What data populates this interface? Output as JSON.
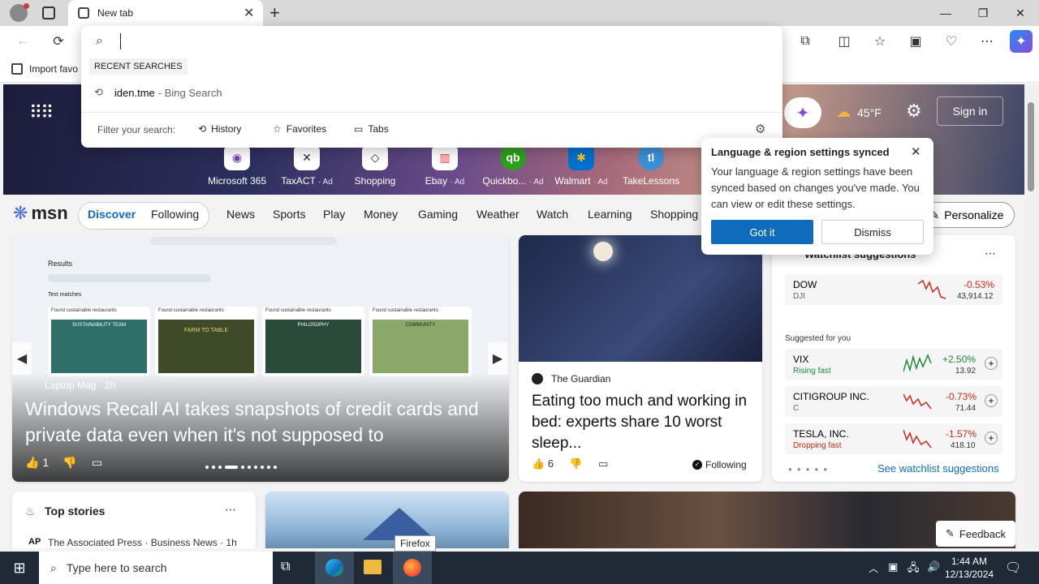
{
  "tab": {
    "title": "New tab"
  },
  "omnibox": {
    "recent_label": "RECENT SEARCHES",
    "recent_item": "iden.tme",
    "recent_item_suffix": "- Bing Search",
    "filter_label": "Filter your search:",
    "filters": [
      "History",
      "Favorites",
      "Tabs"
    ]
  },
  "favbar": {
    "import_label": "Import favo"
  },
  "hero": {
    "weather_temp": "45°F",
    "signin_label": "Sign in",
    "quicklinks": [
      {
        "label": "Microsoft 365",
        "ad": ""
      },
      {
        "label": "TaxACT",
        "ad": "· Ad"
      },
      {
        "label": "Shopping",
        "ad": ""
      },
      {
        "label": "Ebay",
        "ad": "· Ad"
      },
      {
        "label": "Quickbo...",
        "ad": "· Ad"
      },
      {
        "label": "Walmart",
        "ad": "· Ad"
      },
      {
        "label": "TakeLessons",
        "ad": ""
      }
    ]
  },
  "nav": {
    "brand": "msn",
    "discover": "Discover",
    "following": "Following",
    "items": [
      "News",
      "Sports",
      "Play",
      "Money",
      "Gaming",
      "Weather",
      "Watch",
      "Learning",
      "Shopping"
    ],
    "personalize": "Personalize"
  },
  "popup": {
    "title": "Language & region settings synced",
    "body": "Your language & region settings have been synced based on changes you've made. You can view or edit these settings.",
    "got_it": "Got it",
    "dismiss": "Dismiss"
  },
  "main_story": {
    "source": "Laptop Mag · 2h",
    "headline": "Windows Recall AI takes snapshots of credit cards and private data even when it's not supposed to",
    "likes": "1",
    "preview": {
      "results": "Results",
      "text_matches": "Text matches",
      "tile_title": "Found sustainable restaurants",
      "tiles": [
        "SUSTAINABILITY TEAM",
        "FARM TO TABLE",
        "PHILOSOPHY",
        "COMMUNITY"
      ]
    }
  },
  "guardian": {
    "source": "The Guardian",
    "headline": "Eating too much and working in bed: experts share 10 worst sleep...",
    "likes": "6",
    "following": "Following"
  },
  "watchlist": {
    "title": "Watchlist suggestions",
    "primary": {
      "name": "DOW",
      "ticker": "DJI",
      "change": "-0.53%",
      "value": "43,914.12"
    },
    "suggested_label": "Suggested for you",
    "items": [
      {
        "name": "VIX",
        "sub": "Rising fast",
        "change": "+2.50%",
        "value": "13.92",
        "color": "#1a8a3a"
      },
      {
        "name": "CITIGROUP INC.",
        "sub": "C",
        "change": "-0.73%",
        "value": "71.44",
        "color": "#c42b1c"
      },
      {
        "name": "TESLA, INC.",
        "sub": "Dropping fast",
        "change": "-1.57%",
        "value": "418.10",
        "color": "#c42b1c"
      }
    ],
    "see_more": "See watchlist suggestions"
  },
  "top_stories": {
    "title": "Top stories",
    "source": "The Associated Press · Business News · 1h"
  },
  "feedback": "Feedback",
  "tooltip": "Firefox",
  "taskbar": {
    "search_placeholder": "Type here to search",
    "time": "1:44 AM",
    "date": "12/13/2024"
  },
  "colors": {
    "accent": "#0f6cbd",
    "up": "#1a8a3a",
    "down": "#c42b1c"
  }
}
